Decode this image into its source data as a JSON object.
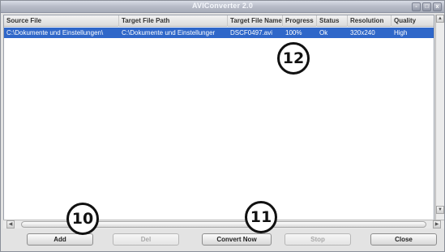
{
  "window": {
    "title": "AVIConverter 2.0",
    "controls": [
      "-",
      "□",
      "x"
    ]
  },
  "table": {
    "headers": [
      "Source File",
      "Target File Path",
      "Target File Name",
      "Progress",
      "Status",
      "Resolution",
      "Quality"
    ],
    "rows": [
      {
        "source": "C:\\Dokumente und Einstellungen\\",
        "target_path": "C:\\Dokumente und Einstellunger",
        "target_name": "DSCF0497.avi",
        "progress": "100%",
        "status": "Ok",
        "resolution": "320x240",
        "quality": "High"
      }
    ]
  },
  "buttons": {
    "add": "Add",
    "del": "Del",
    "convert": "Convert Now",
    "stop": "Stop",
    "close": "Close"
  },
  "callouts": {
    "c10": "10",
    "c11": "11",
    "c12": "12"
  },
  "colors": {
    "selection": "#2f67c9",
    "window_bg": "#e3e3e3"
  }
}
